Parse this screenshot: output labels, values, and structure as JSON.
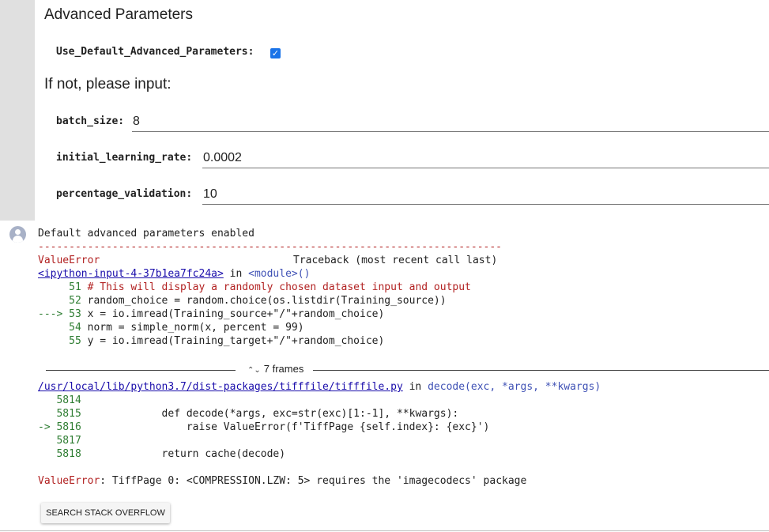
{
  "form": {
    "title": "Advanced Parameters",
    "use_default_label": "Use_Default_Advanced_Parameters:",
    "use_default_checked": true,
    "subtitle": "If not, please input:",
    "fields": [
      {
        "label": "batch_size:",
        "value": "8"
      },
      {
        "label": "initial_learning_rate:",
        "value": "0.0002"
      },
      {
        "label": "percentage_validation:",
        "value": "10"
      }
    ]
  },
  "output": {
    "message": "Default advanced parameters enabled",
    "separator": "---------------------------------------------------------------------------",
    "error_type": "ValueError",
    "traceback_header": "Traceback (most recent call last)",
    "frame1": {
      "file_link": "<ipython-input-4-37b1ea7fc24a>",
      "in_text": " in ",
      "func": "<module>()",
      "lines": [
        {
          "prefix": "     51 ",
          "code": "# This will display a randomly chosen dataset input and output"
        },
        {
          "prefix": "     52 ",
          "code": "random_choice = random.choice(os.listdir(Training_source))"
        },
        {
          "prefix": "---> 53 ",
          "code": "x = io.imread(Training_source+\"/\"+random_choice)"
        },
        {
          "prefix": "     54 ",
          "code": "norm = simple_norm(x, percent = 99)"
        },
        {
          "prefix": "     55 ",
          "code": "y = io.imread(Training_target+\"/\"+random_choice)"
        }
      ]
    },
    "frames_label": "7 frames",
    "frame2": {
      "file_link": "/usr/local/lib/python3.7/dist-packages/tifffile/tifffile.py",
      "in_text": " in ",
      "func": "decode(exc, *args, **kwargs)",
      "lines": [
        {
          "prefix": "   5814",
          "code": ""
        },
        {
          "prefix": "   5815 ",
          "code": "            def decode(*args, exc=str(exc)[1:-1], **kwargs):"
        },
        {
          "prefix": "-> 5816 ",
          "code": "                raise ValueError(f'TiffPage {self.index}: {exc}')"
        },
        {
          "prefix": "   5817",
          "code": ""
        },
        {
          "prefix": "   5818 ",
          "code": "            return cache(decode)"
        }
      ]
    },
    "final_error_type": "ValueError",
    "final_error_msg": ": TiffPage 0: <COMPRESSION.LZW: 5> requires the 'imagecodecs' package",
    "search_button": "SEARCH STACK OVERFLOW"
  }
}
